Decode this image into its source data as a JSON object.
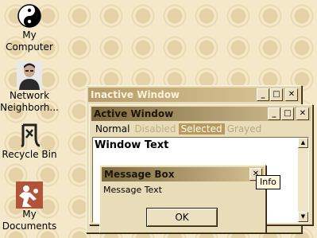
{
  "desktop": {
    "icons": [
      {
        "name": "my-computer",
        "label": "My Computer",
        "icon": "yin-yang-icon"
      },
      {
        "name": "network-neighborhood",
        "label": "Network Neighborh...",
        "icon": "person-portrait-icon"
      },
      {
        "name": "recycle-bin",
        "label": "Recycle Bin",
        "icon": "calligraphy-icon"
      },
      {
        "name": "my-documents",
        "label": "My Documents",
        "icon": "martial-arts-icon"
      }
    ]
  },
  "inactive_window": {
    "title": "Inactive Window"
  },
  "active_window": {
    "title": "Active Window",
    "menu": {
      "normal": "Normal",
      "disabled": "Disabled",
      "selected": "Selected",
      "grayed": "Grayed"
    },
    "body_text": "Window Text"
  },
  "message_box": {
    "title": "Message Box",
    "text": "Message Text",
    "ok_label": "OK"
  },
  "tooltip": {
    "text": "Info"
  },
  "caption_buttons": {
    "minimize": "_",
    "maximize": "□",
    "close": "✕"
  },
  "colors": {
    "desktop": "#f4e8c8",
    "window_face": "#e9dcb8",
    "active_title": "#7d6a40",
    "inactive_title": "#b79d6a",
    "selected": "#b99a5a"
  }
}
